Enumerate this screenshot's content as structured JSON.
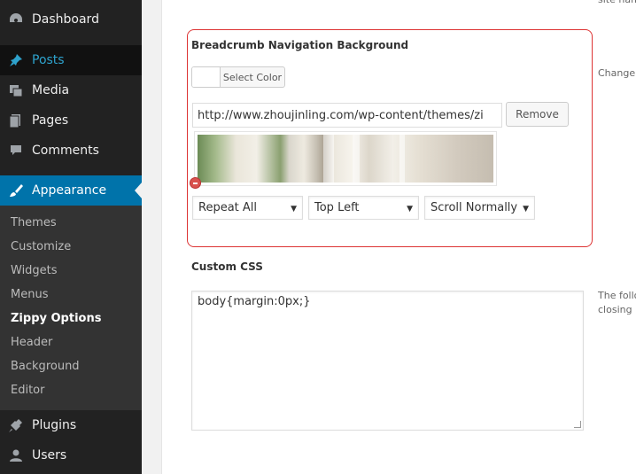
{
  "sidebar": {
    "menu": [
      {
        "label": "Dashboard",
        "icon": "dashboard-icon"
      },
      {
        "label": "Posts",
        "icon": "pushpin-icon"
      },
      {
        "label": "Media",
        "icon": "media-icon"
      },
      {
        "label": "Pages",
        "icon": "pages-icon"
      },
      {
        "label": "Comments",
        "icon": "comment-icon"
      },
      {
        "label": "Appearance",
        "icon": "brush-icon"
      },
      {
        "label": "Plugins",
        "icon": "plugin-icon"
      },
      {
        "label": "Users",
        "icon": "user-icon"
      }
    ],
    "submenu": [
      {
        "label": "Themes"
      },
      {
        "label": "Customize"
      },
      {
        "label": "Widgets"
      },
      {
        "label": "Menus"
      },
      {
        "label": "Zippy Options"
      },
      {
        "label": "Header"
      },
      {
        "label": "Background"
      },
      {
        "label": "Editor"
      }
    ]
  },
  "main": {
    "top_desc": "site name ir",
    "breadcrumb_bg": {
      "title": "Breadcrumb Navigation Background",
      "select_color_label": "Select Color",
      "image_url": "http://www.zhoujinling.com/wp-content/themes/zi",
      "remove_label": "Remove",
      "desc": "Change the",
      "repeat": "Repeat All",
      "position": "Top Left",
      "attachment": "Scroll Normally"
    },
    "custom_css": {
      "title": "Custom CSS",
      "value": "body{margin:0px;}",
      "desc_line1": "The followin",
      "desc_line2": "closing </he"
    }
  },
  "colors": {
    "sidebar_bg": "#222222",
    "submenu_bg": "#333333",
    "current_menu_bg": "#0073aa",
    "highlight_border": "#dd3333",
    "remove_dot": "#d9534f"
  }
}
